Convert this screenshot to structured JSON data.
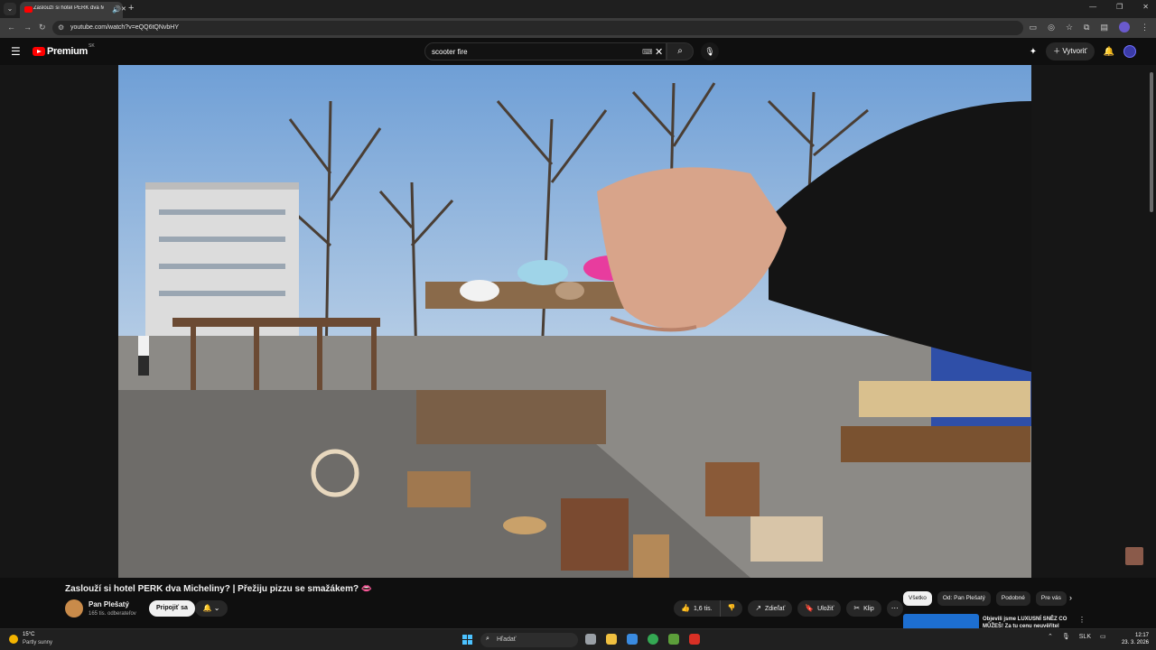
{
  "browser": {
    "tab_title": "Zaslouží si hotel PERK dva M",
    "url": "youtube.com/watch?v=eQQ6tQNvbHY"
  },
  "youtube": {
    "brand": "Premium",
    "country_code": "SK",
    "search_query": "scooter fire",
    "create_label": "Vytvoriť"
  },
  "video": {
    "title": "Zaslouží si hotel PERK dva Micheliny? | Přežiju pizzu se smažákem? 👄",
    "channel_name": "Pan Plešatý",
    "subscribers": "165 tis. odberateľov",
    "join_label": "Pripojiť sa",
    "likes": "1,6 tis.",
    "share_label": "Zdieľať",
    "save_label": "Uložiť",
    "clip_label": "Klip"
  },
  "recommendations": {
    "chips": [
      "Všetko",
      "Od: Pan Plešatý",
      "Podobné",
      "Pre vás"
    ],
    "first_title": "Objevili jsme LUXUSNÍ SNĚZ CO MŮŽEŠ! Za tu cenu neuvěřitel"
  },
  "taskbar": {
    "temperature": "15°C",
    "weather": "Partly sunny",
    "search_placeholder": "Hľadať",
    "language": "SLK",
    "time": "12:17",
    "date": "23. 3. 2026"
  },
  "colors": {
    "youtube_red": "#ff0000",
    "background": "#0f0f0f",
    "pill": "#272727",
    "windows_accent": "#4cc2ff"
  }
}
